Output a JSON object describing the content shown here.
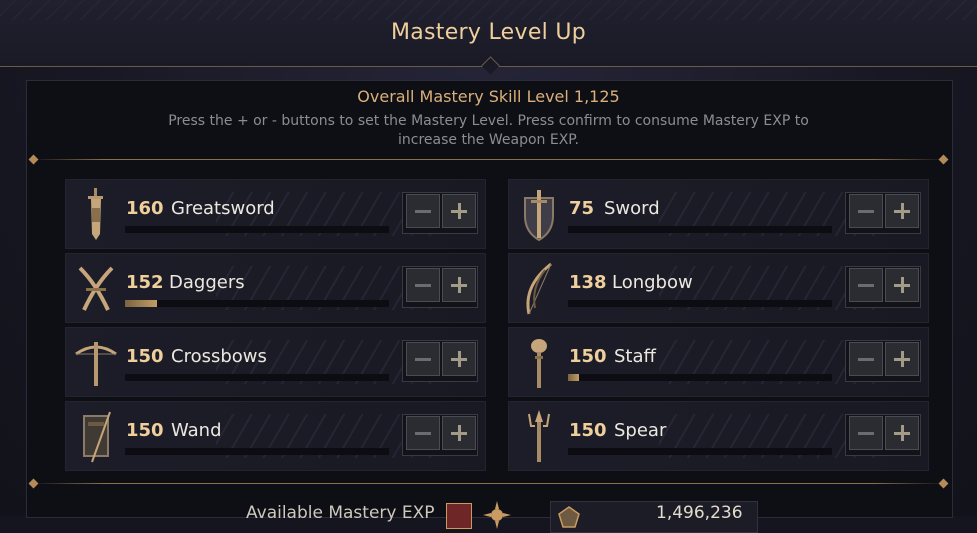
{
  "header": {
    "title": "Mastery Level Up"
  },
  "summary": {
    "overall": "Overall Mastery Skill Level 1,125",
    "instructions": "Press the + or - buttons to set the Mastery Level. Press confirm to consume Mastery EXP to increase the Weapon EXP."
  },
  "weapons": [
    {
      "level": "160",
      "name": "Greatsword",
      "icon": "greatsword-icon",
      "progress": 0
    },
    {
      "level": "75",
      "name": "Sword",
      "icon": "sword-shield-icon",
      "progress": 0
    },
    {
      "level": "152",
      "name": "Daggers",
      "icon": "daggers-icon",
      "progress": 0.12
    },
    {
      "level": "138",
      "name": "Longbow",
      "icon": "longbow-icon",
      "progress": 0
    },
    {
      "level": "150",
      "name": "Crossbows",
      "icon": "crossbow-icon",
      "progress": 0
    },
    {
      "level": "150",
      "name": "Staff",
      "icon": "staff-icon",
      "progress": 0.04
    },
    {
      "level": "150",
      "name": "Wand",
      "icon": "wand-tome-icon",
      "progress": 0
    },
    {
      "level": "150",
      "name": "Spear",
      "icon": "spear-icon",
      "progress": 0
    }
  ],
  "footer": {
    "available_label": "Available Mastery EXP",
    "exp_value": "1,496,236"
  },
  "colors": {
    "accent_gold": "#efcf9c",
    "progress_fill": "#c49d66",
    "panel_bg": "#0e0e15",
    "card_bg": "#1d1d29"
  }
}
